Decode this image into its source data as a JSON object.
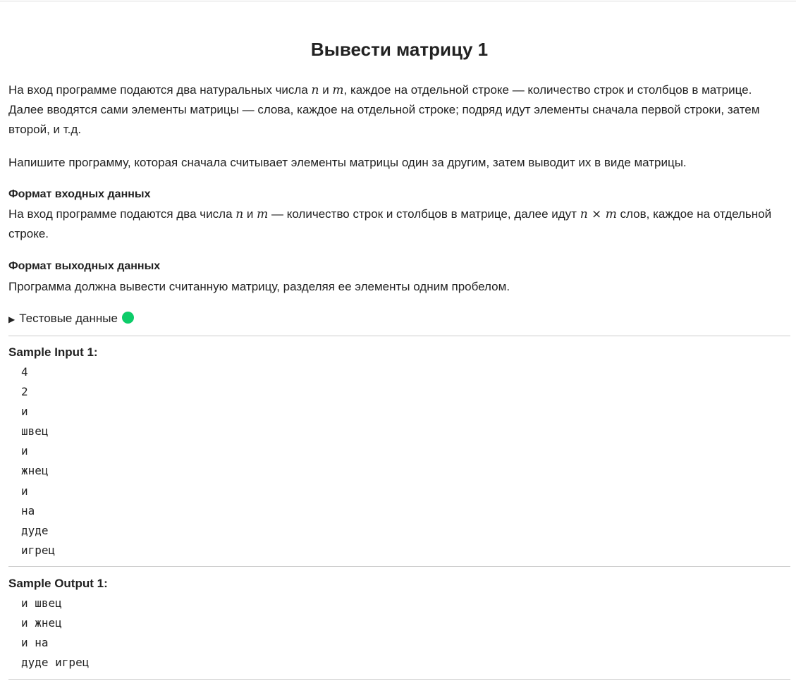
{
  "title": "Вывести матрицу 1",
  "p1": {
    "a": "На вход программе подаются два натуральных числа ",
    "n": "n",
    "b": " и ",
    "m": "m",
    "c": ", каждое на отдельной строке — количество строк и столбцов в матрице. Далее вводятся сами элементы матрицы — слова, каждое на отдельной строке; подряд идут элементы сначала первой строки, затем второй, и т.д."
  },
  "p2": "Напишите программу, которая сначала считывает элементы матрицы один за другим, затем выводит их в виде матрицы.",
  "input_format": {
    "heading": "Формат входных данных",
    "a": "На вход программе подаются два числа ",
    "n": "n",
    "b": " и ",
    "m": "m",
    "c": " — количество строк и столбцов в матрице, далее идут ",
    "nm": "n × m",
    "d": " слов, каждое на отдельной строке."
  },
  "output_format": {
    "heading": "Формат выходных данных",
    "text": "Программа должна вывести считанную матрицу, разделяя ее элементы одним пробелом."
  },
  "test_data": {
    "label": "Тестовые данные",
    "status_color": "#0dcc69"
  },
  "sample_input": {
    "label": "Sample Input 1:",
    "text": "4\n2\nи\nшвец\nи\nжнец\nи\nна\nдуде\nигрец"
  },
  "sample_output": {
    "label": "Sample Output 1:",
    "text": "и швец\nи жнец\nи на\nдуде игрец"
  }
}
